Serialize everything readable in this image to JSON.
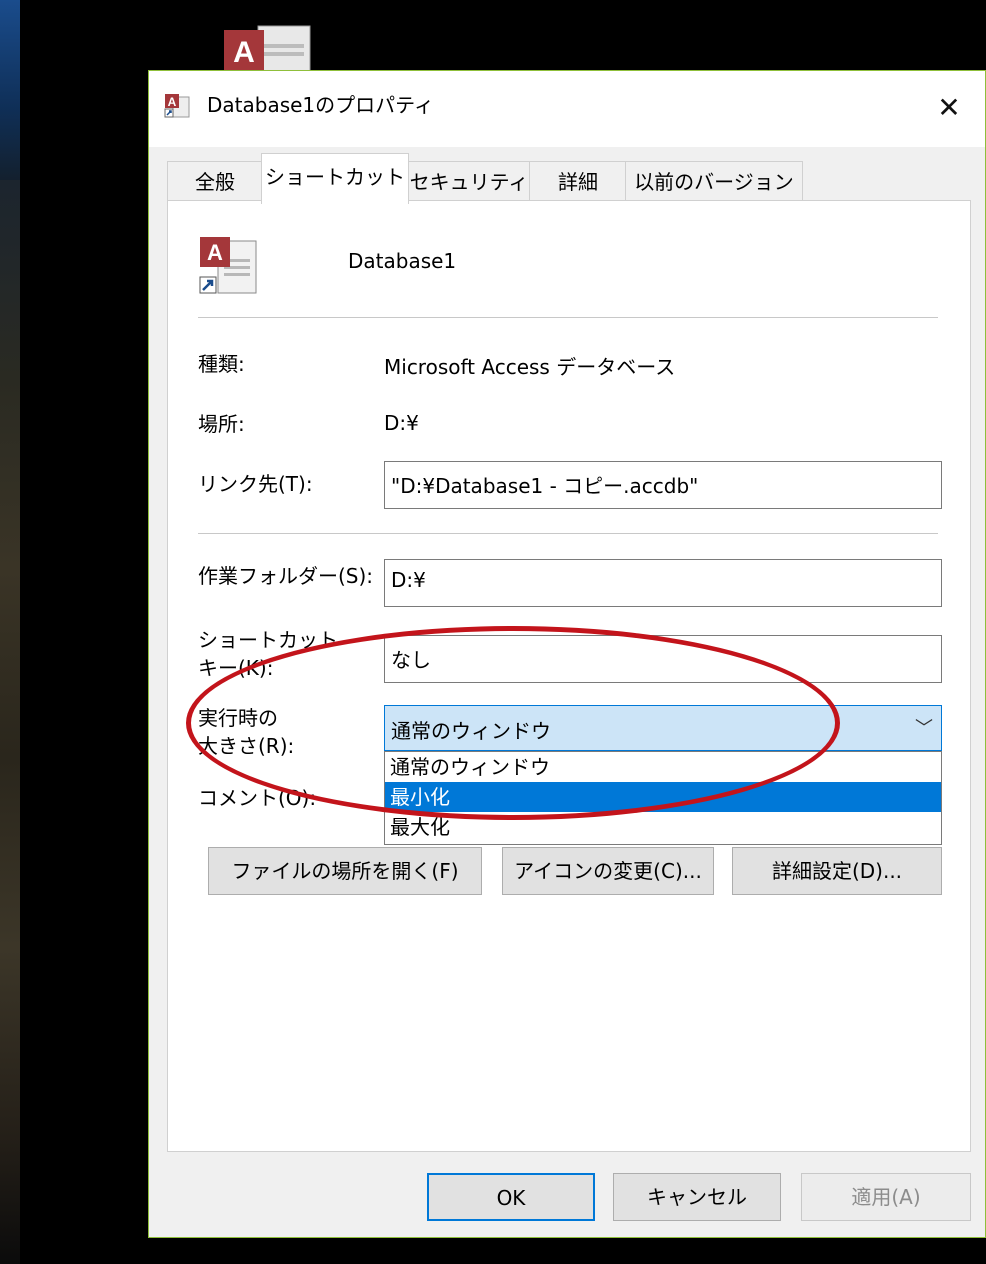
{
  "window": {
    "title": "Database1のプロパティ",
    "close_glyph": "✕"
  },
  "tabs": [
    {
      "label": "全般",
      "active": false
    },
    {
      "label": "ショートカット",
      "active": true
    },
    {
      "label": "セキュリティ",
      "active": false
    },
    {
      "label": "詳細",
      "active": false
    },
    {
      "label": "以前のバージョン",
      "active": false
    }
  ],
  "shortcut": {
    "name": "Database1",
    "type_label": "種類:",
    "type_value": "Microsoft Access データベース",
    "location_label": "場所:",
    "location_value": "D:¥",
    "target_label": "リンク先(T):",
    "target_value": "\"D:¥Database1 - コピー.accdb\"",
    "workdir_label": "作業フォルダー(S):",
    "workdir_value": "D:¥",
    "hotkey_label_line1": "ショートカット",
    "hotkey_label_line2": "キー(K):",
    "hotkey_value": "なし",
    "run_label_line1": "実行時の",
    "run_label_line2": "大きさ(R):",
    "run_selected": "通常のウィンドウ",
    "run_options": [
      "通常のウィンドウ",
      "最小化",
      "最大化"
    ],
    "run_highlighted": "最小化",
    "comment_label": "コメント(O):"
  },
  "buttons": {
    "open_location": "ファイルの場所を開く(F)",
    "change_icon": "アイコンの変更(C)...",
    "advanced": "詳細設定(D)..."
  },
  "footer": {
    "ok": "OK",
    "cancel": "キャンセル",
    "apply": "適用(A)"
  },
  "colors": {
    "accent": "#0078d7",
    "annotation": "#c3141b",
    "dialog_border": "#8fbf3a"
  }
}
